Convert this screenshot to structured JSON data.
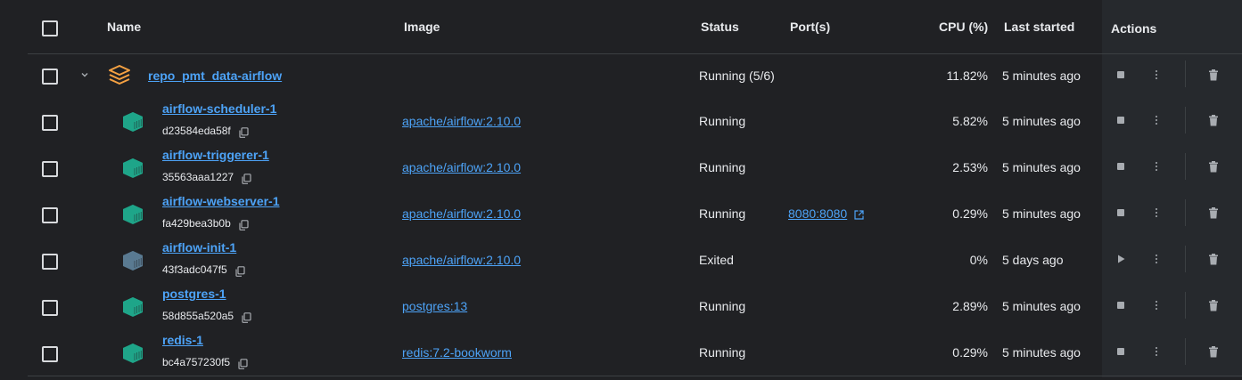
{
  "headers": {
    "name": "Name",
    "image": "Image",
    "status": "Status",
    "ports": "Port(s)",
    "cpu": "CPU (%)",
    "last_started": "Last started",
    "actions": "Actions"
  },
  "group": {
    "name": "repo_pmt_data-airflow",
    "status": "Running (5/6)",
    "cpu": "11.82%",
    "last_started": "5 minutes ago"
  },
  "containers": [
    {
      "name": "airflow-scheduler-1",
      "id": "d23584eda58f",
      "image": "apache/airflow:2.10.0",
      "status": "Running",
      "port": "",
      "cpu": "5.82%",
      "last_started": "5 minutes ago",
      "running": true
    },
    {
      "name": "airflow-triggerer-1",
      "id": "35563aaa1227",
      "image": "apache/airflow:2.10.0",
      "status": "Running",
      "port": "",
      "cpu": "2.53%",
      "last_started": "5 minutes ago",
      "running": true
    },
    {
      "name": "airflow-webserver-1",
      "id": "fa429bea3b0b",
      "image": "apache/airflow:2.10.0",
      "status": "Running",
      "port": "8080:8080",
      "cpu": "0.29%",
      "last_started": "5 minutes ago",
      "running": true
    },
    {
      "name": "airflow-init-1",
      "id": "43f3adc047f5",
      "image": "apache/airflow:2.10.0",
      "status": "Exited",
      "port": "",
      "cpu": "0%",
      "last_started": "5 days ago",
      "running": false
    },
    {
      "name": "postgres-1",
      "id": "58d855a520a5",
      "image": "postgres:13",
      "status": "Running",
      "port": "",
      "cpu": "2.89%",
      "last_started": "5 minutes ago",
      "running": true
    },
    {
      "name": "redis-1",
      "id": "bc4a757230f5",
      "image": "redis:7.2-bookworm",
      "status": "Running",
      "port": "",
      "cpu": "0.29%",
      "last_started": "5 minutes ago",
      "running": true
    }
  ],
  "colors": {
    "link": "#4da3f7",
    "container_running": "#1fa589",
    "container_exited": "#5a7a91",
    "stack_icon": "#f5a142"
  },
  "icons": {
    "copy": "copy-icon",
    "stop": "stop-icon",
    "start": "play-icon",
    "more": "kebab-icon",
    "delete": "trash-icon",
    "external": "external-link-icon",
    "container": "container-icon",
    "stack": "stack-icon"
  }
}
